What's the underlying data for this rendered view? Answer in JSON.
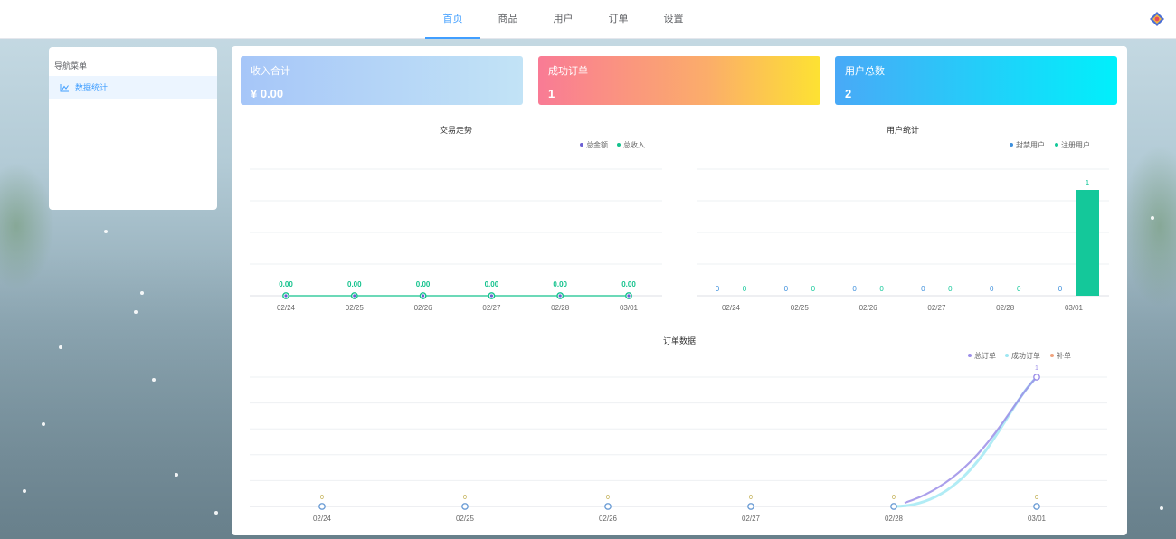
{
  "nav": {
    "items": [
      {
        "label": "首页",
        "active": true
      },
      {
        "label": "商品",
        "active": false
      },
      {
        "label": "用户",
        "active": false
      },
      {
        "label": "订单",
        "active": false
      },
      {
        "label": "设置",
        "active": false
      }
    ]
  },
  "sidebar": {
    "title": "导航菜单",
    "items": [
      {
        "label": "数据统计",
        "icon": "line-chart-icon",
        "active": true
      }
    ]
  },
  "cards": [
    {
      "title": "收入合计",
      "value": "¥ 0.00"
    },
    {
      "title": "成功订单",
      "value": "1"
    },
    {
      "title": "用户总数",
      "value": "2"
    }
  ],
  "colors": {
    "accent": "#409eff",
    "series_total_amount": "#6b5fd3",
    "series_total_income": "#14c28d",
    "series_banned_users": "#3d8fdc",
    "series_registered_users": "#14c89a",
    "series_total_orders": "#9b8ee8",
    "series_success_orders": "#9ee7f2",
    "series_makeup_orders": "#f0a37e"
  },
  "chart_data": [
    {
      "type": "line",
      "title": "交易走势",
      "categories": [
        "02/24",
        "02/25",
        "02/26",
        "02/27",
        "02/28",
        "03/01"
      ],
      "series": [
        {
          "name": "总金额",
          "values": [
            0.0,
            0.0,
            0.0,
            0.0,
            0.0,
            0.0
          ]
        },
        {
          "name": "总收入",
          "values": [
            0.0,
            0.0,
            0.0,
            0.0,
            0.0,
            0.0
          ]
        }
      ],
      "value_labels": [
        "0.00",
        "0.00",
        "0.00",
        "0.00",
        "0.00",
        "0.00"
      ],
      "legend": "top-right",
      "grid": true
    },
    {
      "type": "bar",
      "title": "用户统计",
      "categories": [
        "02/24",
        "02/25",
        "02/26",
        "02/27",
        "02/28",
        "03/01"
      ],
      "series": [
        {
          "name": "封禁用户",
          "values": [
            0,
            0,
            0,
            0,
            0,
            0
          ]
        },
        {
          "name": "注册用户",
          "values": [
            0,
            0,
            0,
            0,
            0,
            1
          ]
        }
      ],
      "ylim": [
        0,
        1
      ],
      "legend": "top-right",
      "grid": true
    },
    {
      "type": "line",
      "title": "订单数据",
      "categories": [
        "02/24",
        "02/25",
        "02/26",
        "02/27",
        "02/28",
        "03/01"
      ],
      "series": [
        {
          "name": "总订单",
          "values": [
            0,
            0,
            0,
            0,
            0,
            1
          ]
        },
        {
          "name": "成功订单",
          "values": [
            0,
            0,
            0,
            0,
            0,
            1
          ]
        },
        {
          "name": "补单",
          "values": [
            0,
            0,
            0,
            0,
            0,
            0
          ]
        }
      ],
      "ylim": [
        0,
        1
      ],
      "legend": "top-right",
      "grid": true
    }
  ]
}
